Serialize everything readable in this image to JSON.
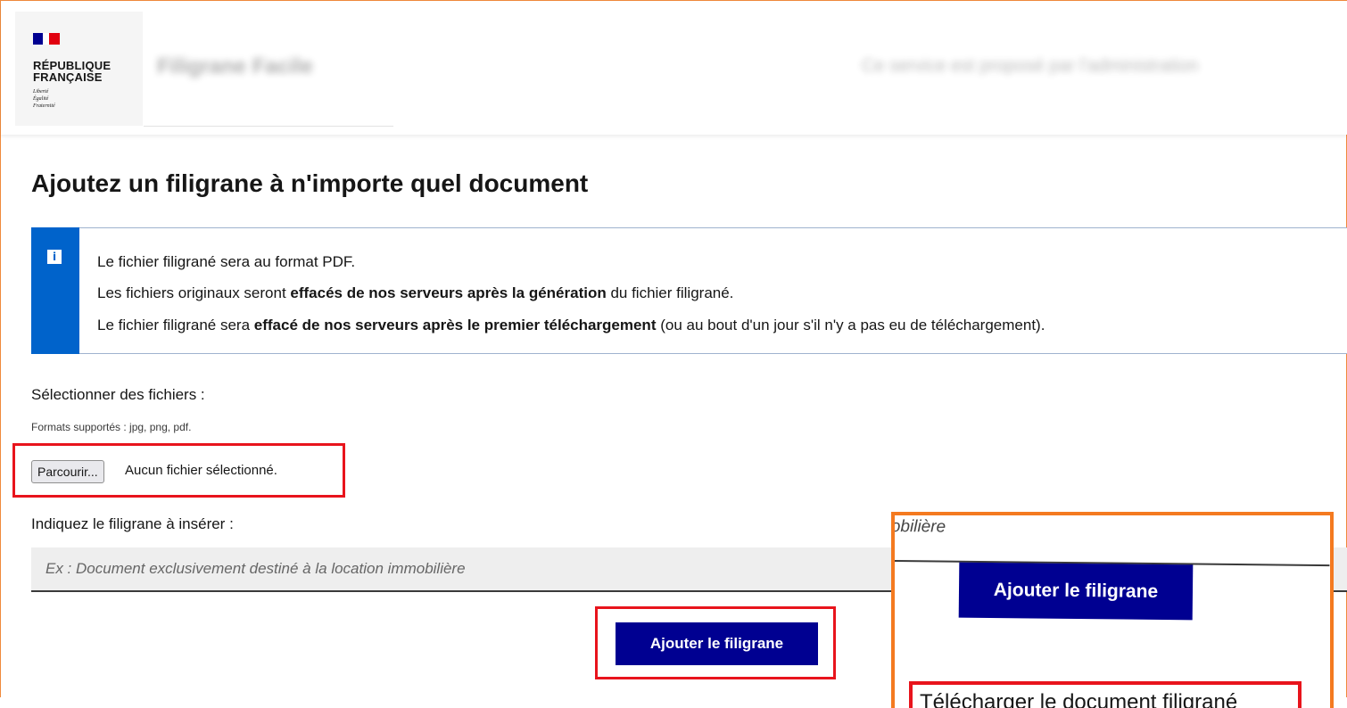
{
  "header": {
    "logo_line1": "RÉPUBLIQUE",
    "logo_line2": "FRANÇAISE",
    "motto": [
      "Liberté",
      "Égalité",
      "Fraternité"
    ],
    "service_title": "Filigrane Facile",
    "service_tagline": "Ce service est proposé par l'administration"
  },
  "page": {
    "title": "Ajoutez un filigrane à n'importe quel document"
  },
  "notice": {
    "icon": "info-icon",
    "line1": "Le fichier filigrané sera au format PDF.",
    "line2_prefix": "Les fichiers originaux seront ",
    "line2_bold": "effacés de nos serveurs après la génération",
    "line2_suffix": " du fichier filigrané.",
    "line3_prefix": "Le fichier filigrané sera ",
    "line3_bold": "effacé de nos serveurs après le premier téléchargement",
    "line3_suffix": " (ou au bout d'un jour s'il n'y a pas eu de téléchargement)."
  },
  "form": {
    "files_label": "Sélectionner des fichiers :",
    "files_hint": "Formats supportés : jpg, png, pdf.",
    "browse_button": "Parcourir...",
    "no_file": "Aucun fichier sélectionné.",
    "watermark_label": "Indiquez le filigrane à insérer :",
    "watermark_placeholder": "Ex : Document exclusivement destiné à la location immobilière",
    "watermark_value": "",
    "submit_button": "Ajouter le filigrane"
  },
  "zoom": {
    "placeholder_fragment": "obilière",
    "button": "Ajouter le filigrane",
    "download_link": "Télécharger le document filigrané"
  },
  "colors": {
    "primary": "#000091",
    "info": "#0063cb",
    "highlight_red": "#e8141c",
    "highlight_orange": "#f47a20"
  }
}
